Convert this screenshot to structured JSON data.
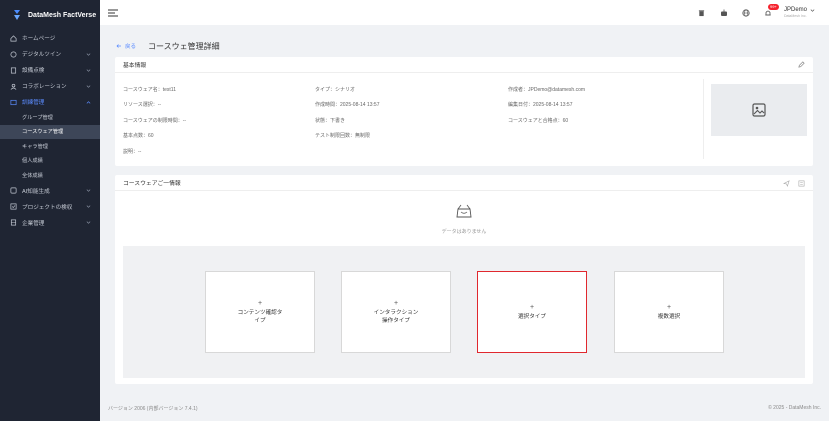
{
  "app": {
    "brand": "DataMesh FactVerse"
  },
  "sidebar": {
    "items": [
      {
        "label": "ホームページ",
        "icon": "home-icon"
      },
      {
        "label": "デジタルツイン",
        "icon": "cube-icon"
      },
      {
        "label": "設備点検",
        "icon": "clipboard-icon"
      },
      {
        "label": "コラボレーション",
        "icon": "users-icon"
      },
      {
        "label": "訓練管理",
        "icon": "training-icon"
      }
    ],
    "sub_items": [
      "グループ管理",
      "コースウェア管理",
      "キャラ管理",
      "個人成績",
      "全体成績"
    ],
    "items_after": [
      {
        "label": "AI知能生成",
        "icon": "ai-icon"
      },
      {
        "label": "プロジェクトの検収",
        "icon": "check-icon"
      },
      {
        "label": "企業管理",
        "icon": "building-icon"
      }
    ]
  },
  "header": {
    "notification_badge": "99+",
    "user_name": "JPDemo",
    "user_company": "DataMesh Inc."
  },
  "page": {
    "back_label": "戻る",
    "title": "コースウェ管理詳細"
  },
  "basic_info": {
    "title": "基本情報",
    "fields": {
      "name": "コースウェア名：test11",
      "type": "タイプ：シナリオ",
      "author": "作成者：JPDemo@datamesh.com",
      "resources": "リソース選択：--",
      "created": "作成時間：2025-08-14 13:57",
      "edited": "編集日付：2025-08-14 13:57",
      "time_limit": "コースウェアの制限時間：--",
      "status": "状態：下書き",
      "pass_score": "コースウェアと合格点：60",
      "base_score": "基本点数：60",
      "test_limit": "テスト制限回数：無制限",
      "description": "説明：--"
    }
  },
  "question_info": {
    "title": "コースウェアご一情報",
    "empty_text": "データはありません",
    "types": [
      {
        "plus": "+",
        "line1": "コンテンツ確認タ",
        "line2": "イプ"
      },
      {
        "plus": "+",
        "line1": "インタラクション",
        "line2": "操作タイプ"
      },
      {
        "plus": "+",
        "line1": "選択タイプ",
        "line2": ""
      },
      {
        "plus": "+",
        "line1": "複数選択",
        "line2": ""
      }
    ]
  },
  "footer": {
    "version": "バージョン 2006 (内部バージョン 7.4.1)",
    "copyright": "© 2025 - DataMesh Inc."
  },
  "colors": {
    "sidebar_bg": "#1f2533",
    "accent": "#5b8cff",
    "selected_border": "#e0282e"
  }
}
